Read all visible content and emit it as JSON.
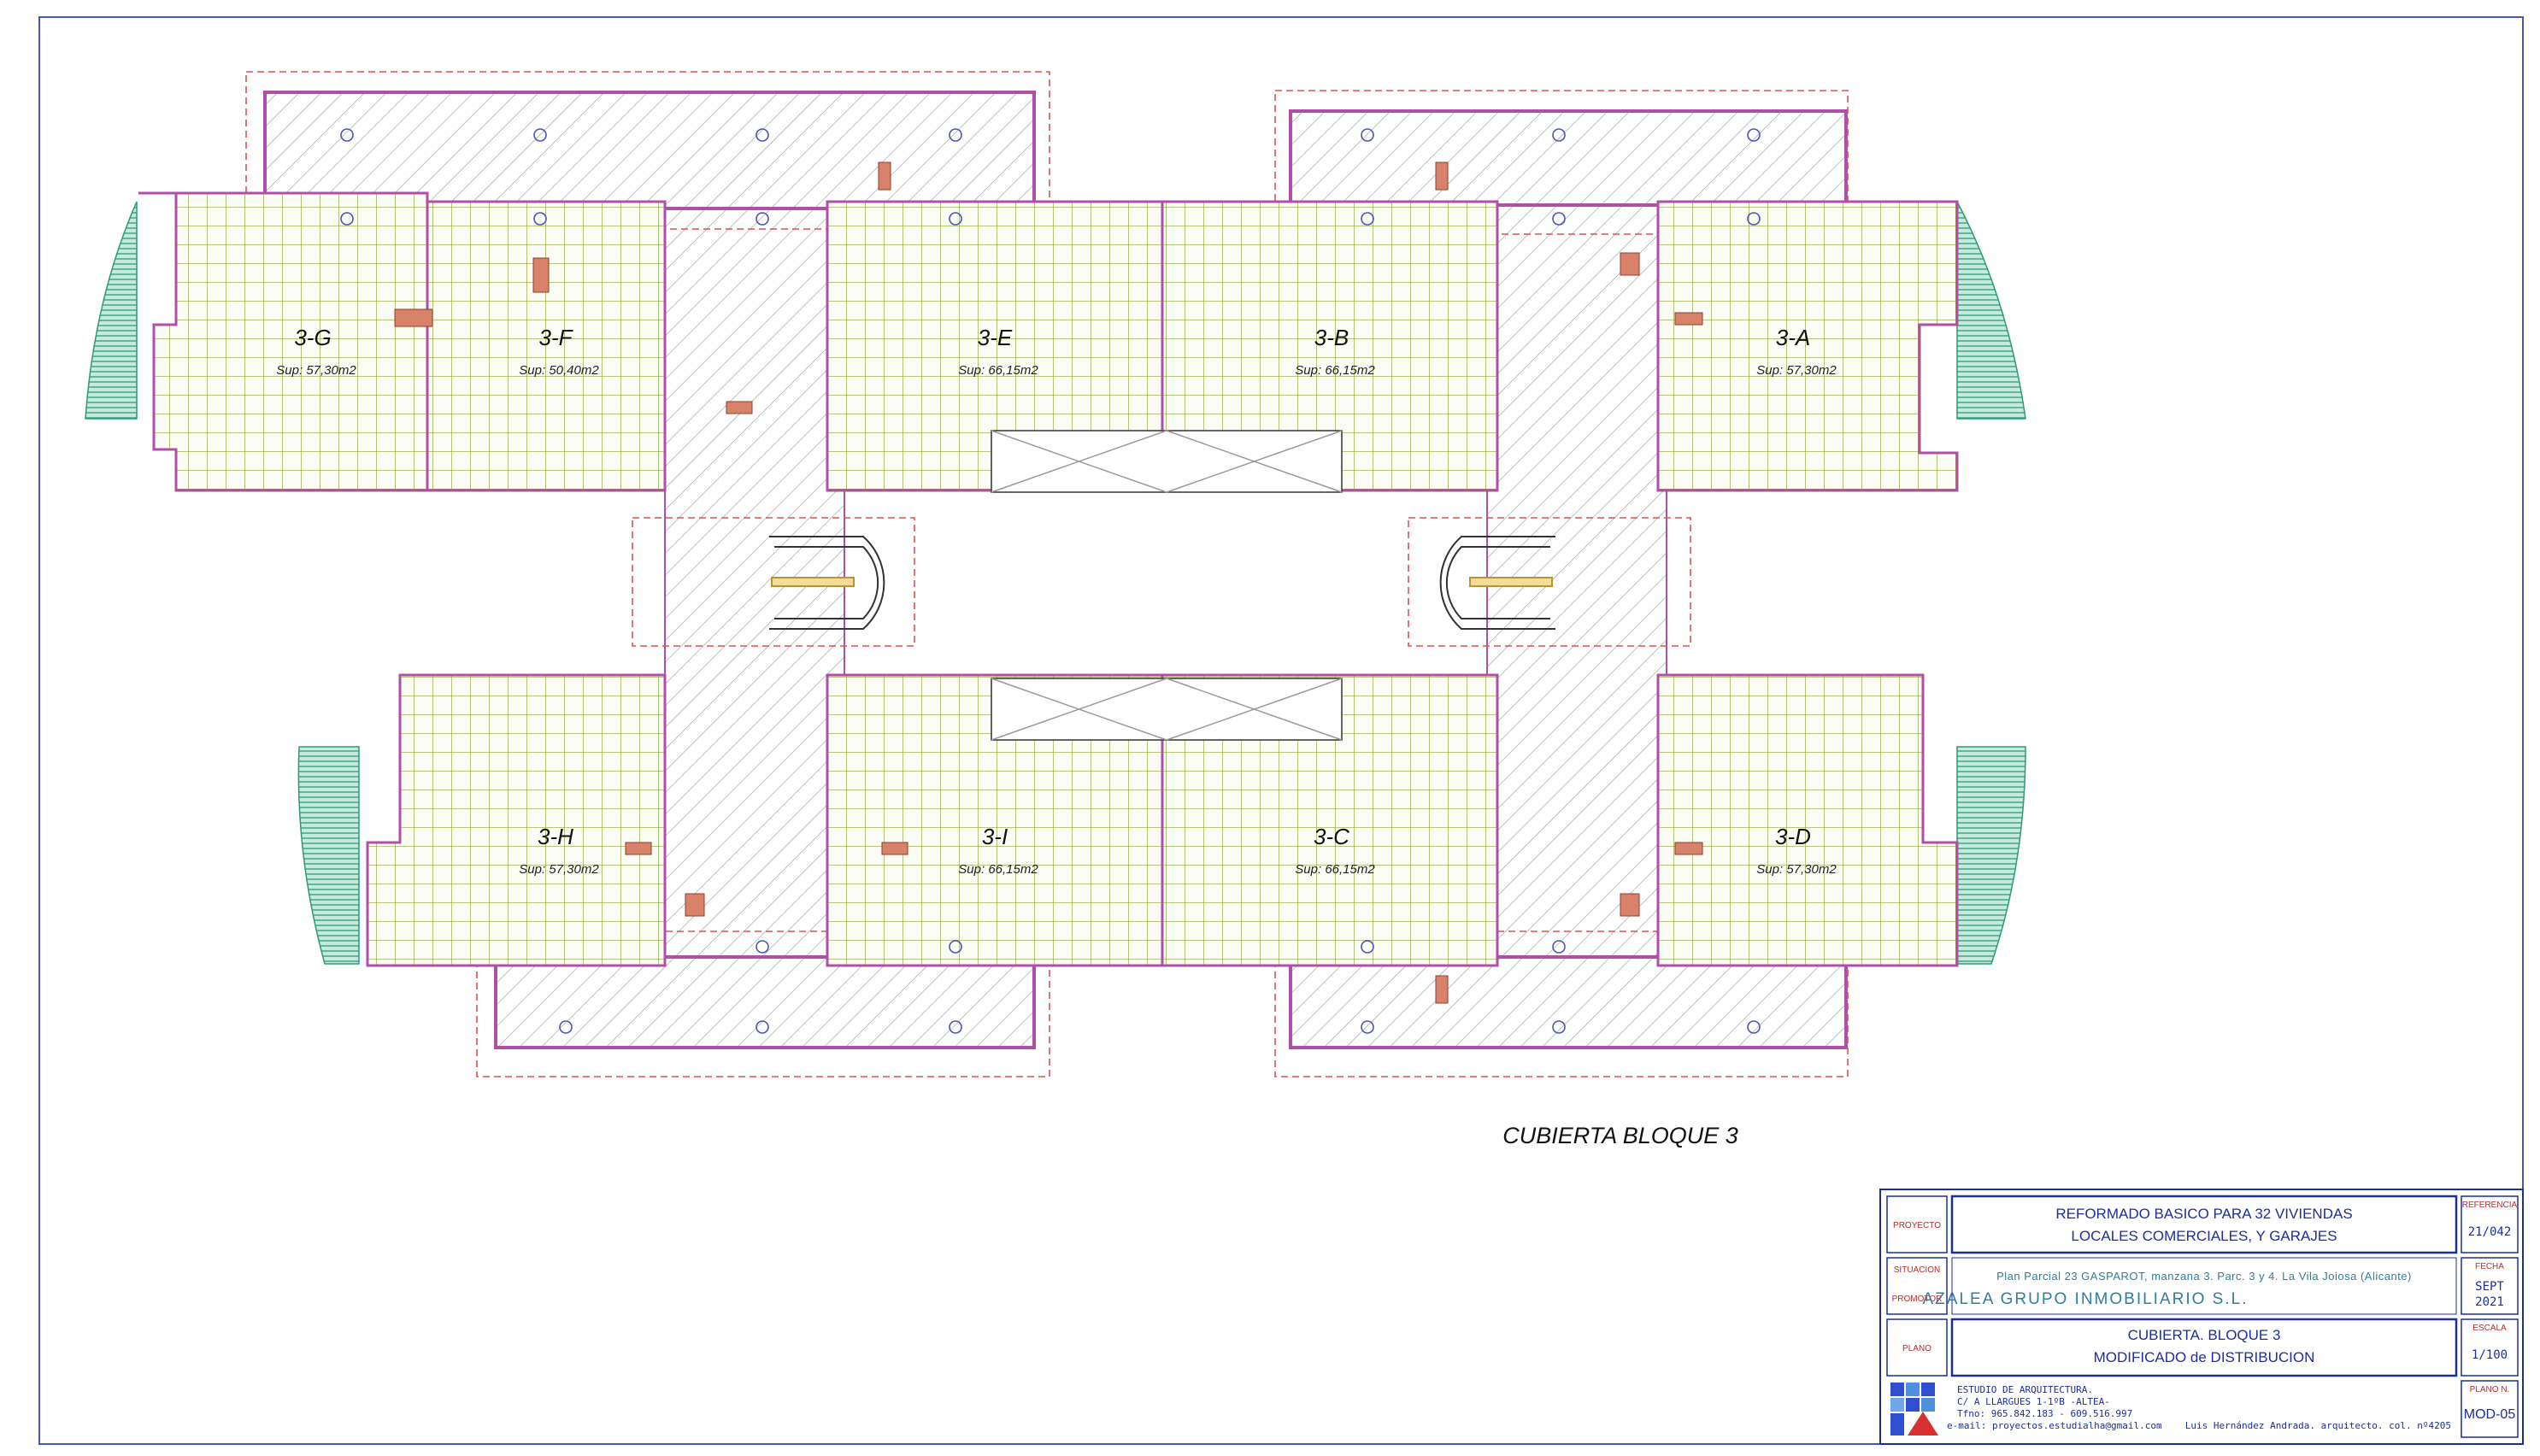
{
  "drawing": {
    "sheet_title": "CUBIERTA BLOQUE 3",
    "units": [
      {
        "code": "3-G",
        "area": "Sup: 57,30m2"
      },
      {
        "code": "3-F",
        "area": "Sup: 50,40m2"
      },
      {
        "code": "3-E",
        "area": "Sup: 66,15m2"
      },
      {
        "code": "3-B",
        "area": "Sup: 66,15m2"
      },
      {
        "code": "3-A",
        "area": "Sup: 57,30m2"
      },
      {
        "code": "3-H",
        "area": "Sup: 57,30m2"
      },
      {
        "code": "3-I",
        "area": "Sup: 66,15m2"
      },
      {
        "code": "3-C",
        "area": "Sup: 66,15m2"
      },
      {
        "code": "3-D",
        "area": "Sup: 57,30m2"
      }
    ]
  },
  "title_block": {
    "labels": {
      "proyecto": "PROYECTO",
      "situacion": "SITUACION",
      "promotor": "PROMOTOR",
      "plano": "PLANO",
      "referencia": "REFERENCIA",
      "fecha": "FECHA",
      "escala": "ESCALA",
      "plano_n": "PLANO N."
    },
    "project_line1": "REFORMADO BASICO PARA 32 VIVIENDAS",
    "project_line2": "LOCALES COMERCIALES, Y GARAJES",
    "situation": "Plan Parcial 23 GASPAROT, manzana 3. Parc. 3 y 4. La Vila Joiosa (Alicante)",
    "promoter": "AZALEA GRUPO INMOBILIARIO S.L.",
    "plan_line1": "CUBIERTA. BLOQUE 3",
    "plan_line2": "MODIFICADO de DISTRIBUCION",
    "reference": "21/042",
    "date_month": "SEPT",
    "date_year": "2021",
    "scale": "1/100",
    "plan_number": "MOD-05",
    "studio_name": "ESTUDIO DE ARQUITECTURA.",
    "studio_address": "C/ A LLARGUES 1-1ºB  -ALTEA-",
    "studio_phone": "Tfno: 965.842.183 - 609.516.997",
    "studio_email": "e-mail: proyectos.estudialha@gmail.com",
    "architect": "Luis Hernández Andrada. arquitecto. col. nº4205"
  },
  "colors": {
    "wall": "#b04fa8",
    "grid": "#8fa23a",
    "hatch": "#9a9a9a",
    "dashed": "#e05050",
    "terrace": "#2f9a7a",
    "vent": "#d9826a",
    "titleblock": "#1c2f9c"
  }
}
